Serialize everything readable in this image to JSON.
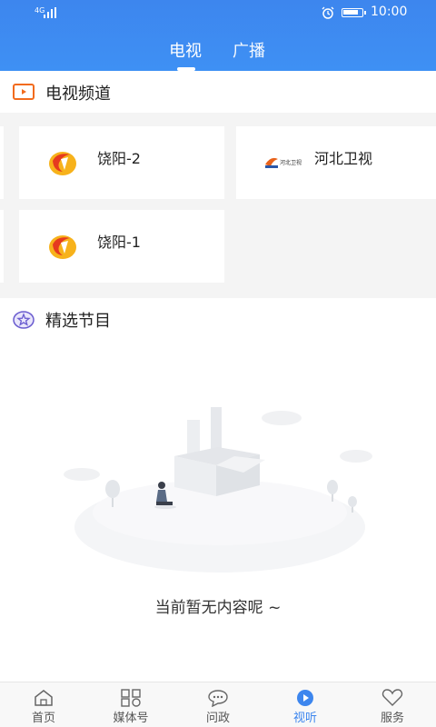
{
  "status_bar": {
    "network": "4G",
    "time": "10:00"
  },
  "tabs": [
    {
      "label": "电视",
      "active": true
    },
    {
      "label": "广播",
      "active": false
    }
  ],
  "tv_section": {
    "title": "电视频道",
    "channels": [
      {
        "name": "饶阳-2",
        "logo": "raoyang-logo"
      },
      {
        "name": "河北卫视",
        "logo": "hebei-tv-logo",
        "logo_text": "河北卫视"
      },
      {
        "name": "饶阳-1",
        "logo": "raoyang-logo"
      }
    ]
  },
  "featured_section": {
    "title": "精选节目",
    "empty_text": "当前暂无内容呢 ~"
  },
  "bottom_nav": [
    {
      "label": "首页",
      "icon": "home-icon",
      "active": false
    },
    {
      "label": "媒体号",
      "icon": "grid-icon",
      "active": false
    },
    {
      "label": "问政",
      "icon": "chat-icon",
      "active": false
    },
    {
      "label": "视听",
      "icon": "play-icon",
      "active": true
    },
    {
      "label": "服务",
      "icon": "heart-icon",
      "active": false
    }
  ],
  "colors": {
    "brand_blue": "#3d86ee",
    "tv_icon_orange": "#f26b1d",
    "star_icon_purple": "#6a5ccf"
  }
}
